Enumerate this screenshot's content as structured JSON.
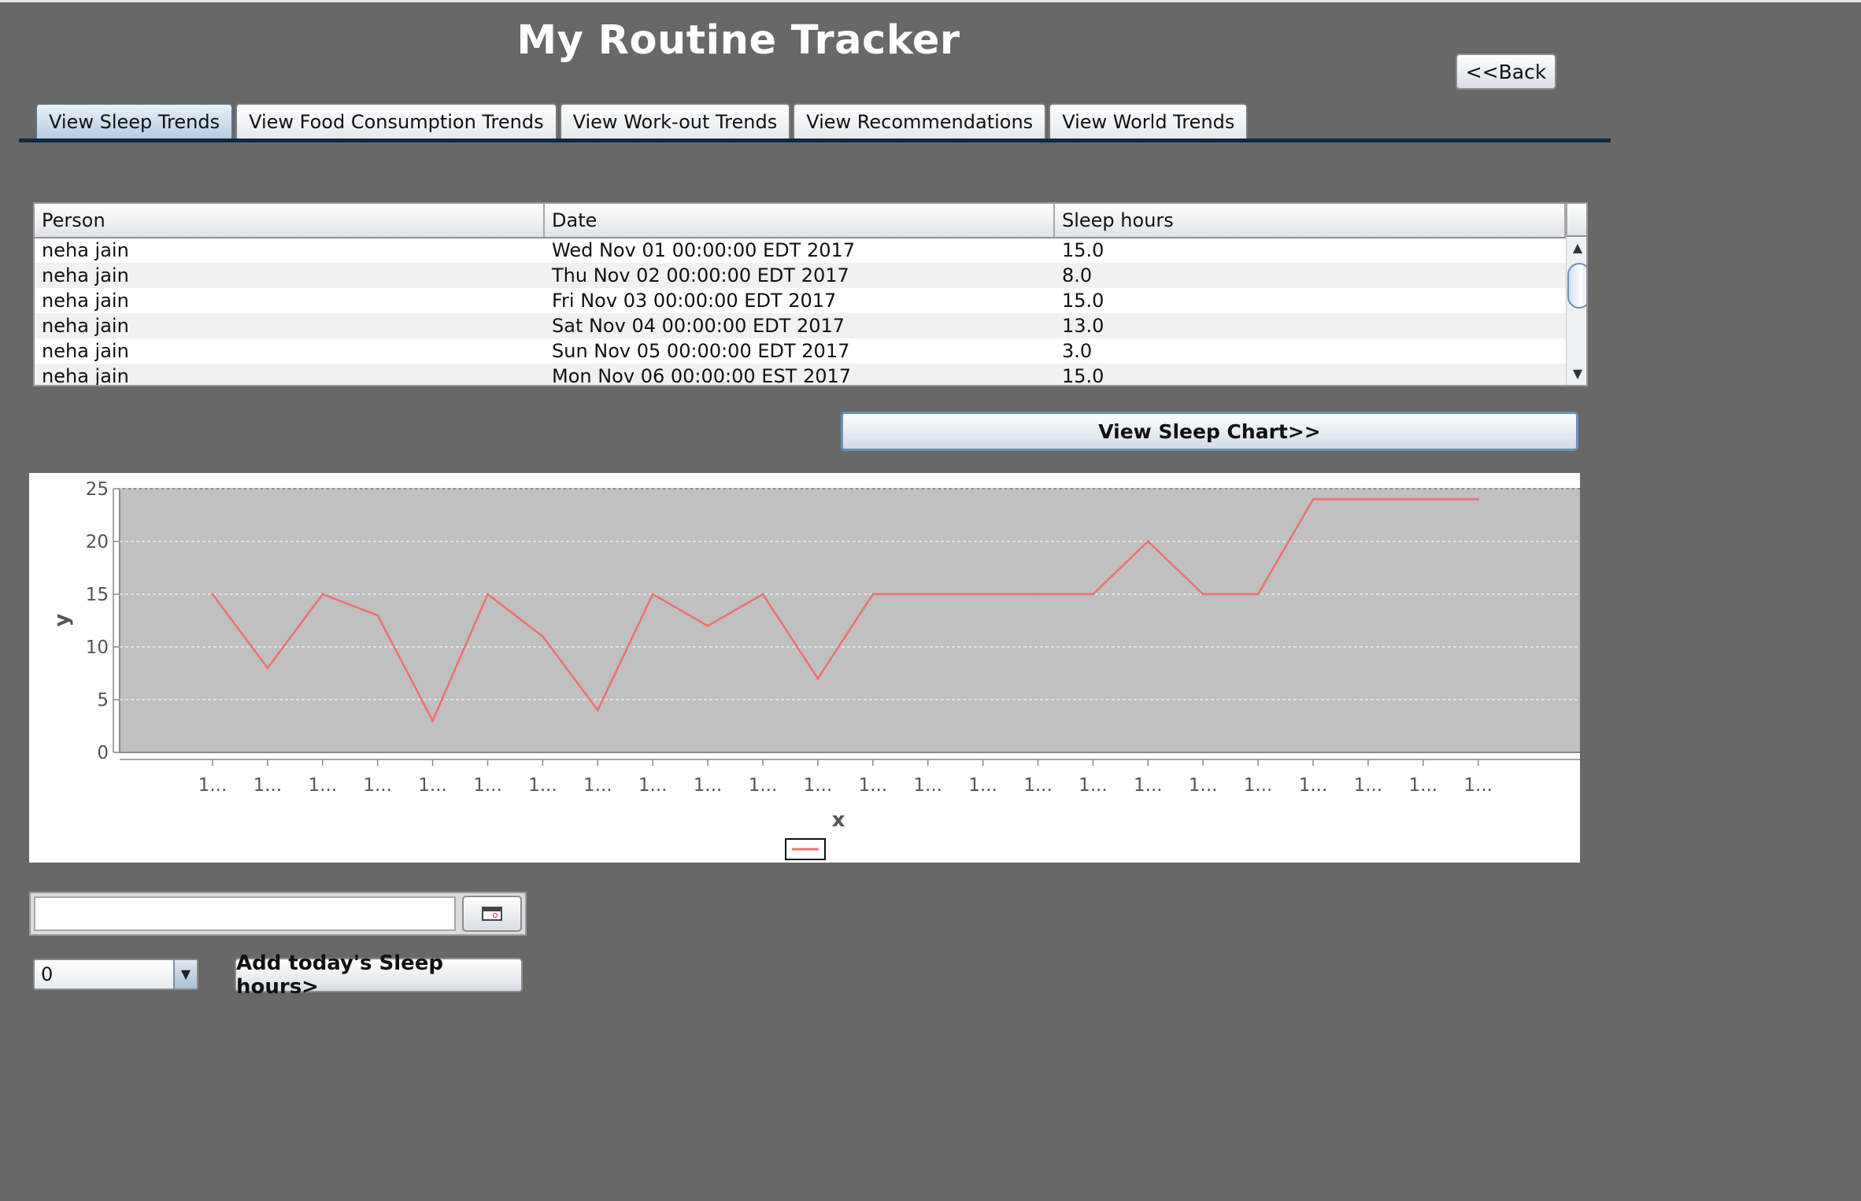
{
  "app": {
    "title": "My Routine Tracker"
  },
  "header": {
    "back_label": "<<Back"
  },
  "tabs": [
    {
      "label": "View Sleep Trends",
      "active": true
    },
    {
      "label": "View Food Consumption Trends",
      "active": false
    },
    {
      "label": "View Work-out Trends",
      "active": false
    },
    {
      "label": "View Recommendations",
      "active": false
    },
    {
      "label": "View World Trends",
      "active": false
    }
  ],
  "table": {
    "columns": [
      "Person",
      "Date",
      "Sleep hours"
    ],
    "rows": [
      [
        "neha jain",
        "Wed Nov 01 00:00:00 EDT 2017",
        "15.0"
      ],
      [
        "neha jain",
        "Thu Nov 02 00:00:00 EDT 2017",
        "8.0"
      ],
      [
        "neha jain",
        "Fri Nov 03 00:00:00 EDT 2017",
        "15.0"
      ],
      [
        "neha jain",
        "Sat Nov 04 00:00:00 EDT 2017",
        "13.0"
      ],
      [
        "neha jain",
        "Sun Nov 05 00:00:00 EDT 2017",
        "3.0"
      ],
      [
        "neha jain",
        "Mon Nov 06 00:00:00 EST 2017",
        "15.0"
      ]
    ]
  },
  "actions": {
    "view_chart_label": "View Sleep Chart>>",
    "add_sleep_label": "Add today's Sleep hours>"
  },
  "controls": {
    "date_value": "",
    "hours_selected": "0"
  },
  "chart_data": {
    "type": "line",
    "xlabel": "x",
    "ylabel": "y",
    "ylim": [
      0,
      25
    ],
    "yticks": [
      0,
      5,
      10,
      15,
      20,
      25
    ],
    "x_tick_label": "1...",
    "grid": true,
    "legend": "bottom-center",
    "plot_background": "#c0c0c0",
    "line_color": "#f07070",
    "series": [
      {
        "values": [
          15,
          8,
          15,
          13,
          3,
          15,
          11,
          4,
          15,
          12,
          15,
          7,
          15,
          15,
          15,
          15,
          15,
          20,
          15,
          15,
          24,
          24,
          24,
          24
        ]
      }
    ]
  }
}
